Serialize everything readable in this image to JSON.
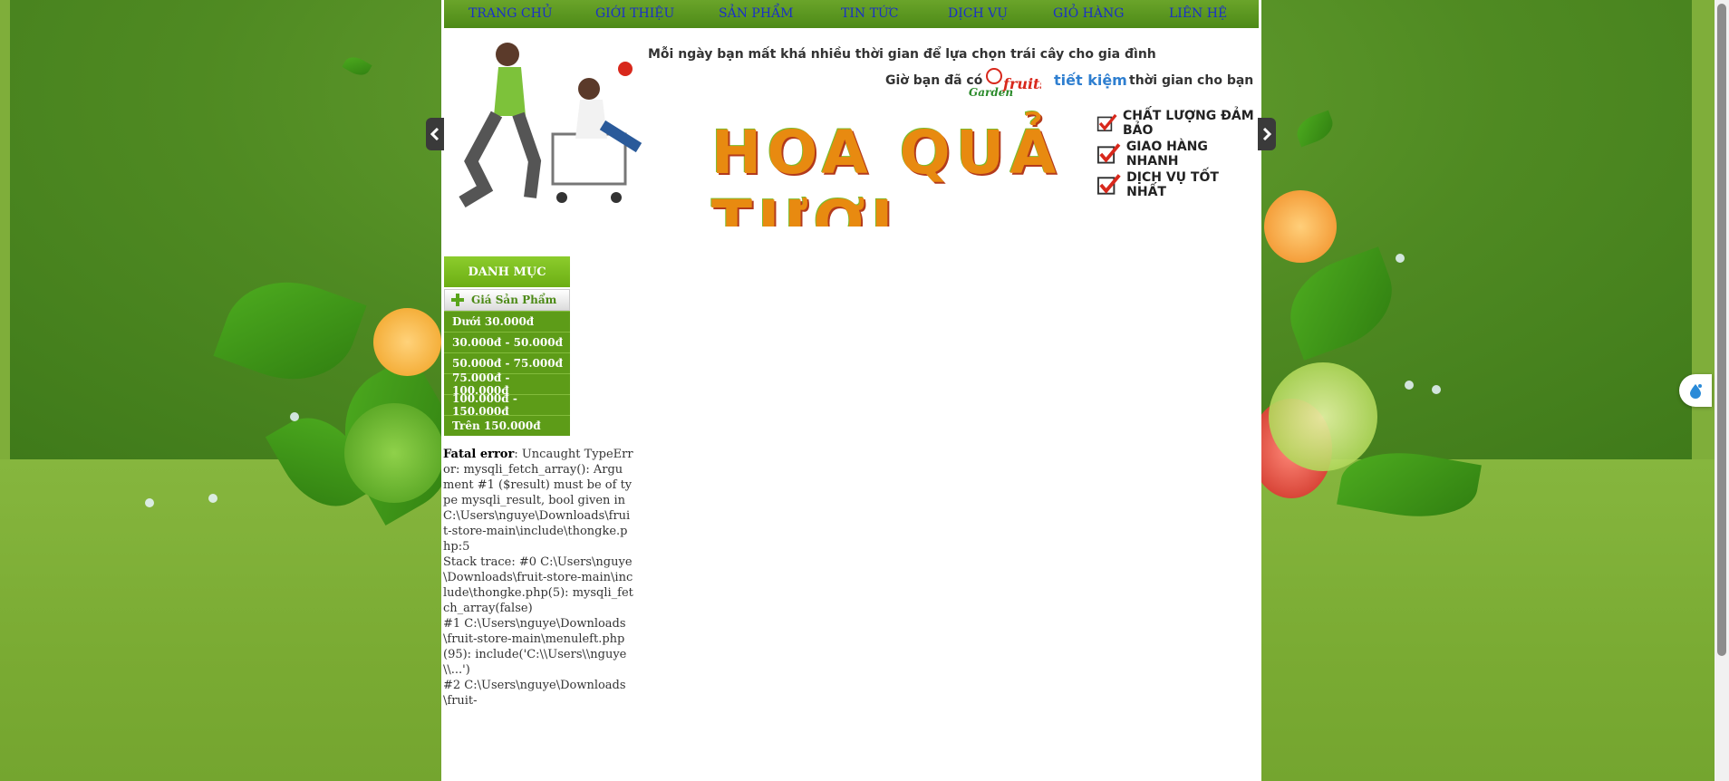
{
  "nav": {
    "items": [
      "TRANG CHỦ",
      "GIỚI THIỆU",
      "SẢN PHẨM",
      "TIN TỨC",
      "DỊCH VỤ",
      "GIỎ HÀNG",
      "LIÊN HỆ"
    ]
  },
  "banner": {
    "tagline1": "Mỗi ngày bạn mất khá nhiều thời gian để lựa chọn trái cây cho gia đình",
    "tagline2": "Giờ bạn đã có",
    "brand_logo": "Garden fruits",
    "highlight": "tiết kiệm",
    "tagline3": "thời gian cho bạn",
    "title": "HOA QUẢ TƯƠI",
    "features": [
      "CHẤT LƯỢNG ĐẢM BẢO",
      "GIAO HÀNG NHANH",
      "DỊCH VỤ TỐT NHẤT"
    ]
  },
  "sidebar": {
    "header": "DANH MỤC",
    "group_label": "Giá Sản Phẩm",
    "price_ranges": [
      "Dưới 30.000đ",
      "30.000đ - 50.000đ",
      "50.000đ - 75.000đ",
      "75.000đ - 100.000đ",
      "100.000đ - 150.000đ",
      "Trên 150.000đ"
    ]
  },
  "error": {
    "label": "Fatal error",
    "message": ": Uncaught TypeError: mysqli_fetch_array(): Argument #1 ($result) must be of type mysqli_result, bool given in C:\\Users\\nguye\\Downloads\\fruit-store-main\\include\\thongke.php:5\nStack trace: #0 C:\\Users\\nguye\\Downloads\\fruit-store-main\\include\\thongke.php(5): mysqli_fetch_array(false)\n#1 C:\\Users\\nguye\\Downloads\\fruit-store-main\\menuleft.php(95): include('C:\\\\Users\\\\nguye\\\\...')\n#2 C:\\Users\\nguye\\Downloads\\fruit-"
  },
  "colors": {
    "nav_bg": "#5a9a1f",
    "nav_link": "#1a30c8",
    "sidebar_header": "#7dbd1f",
    "sidebar_item": "#5d9c18"
  }
}
